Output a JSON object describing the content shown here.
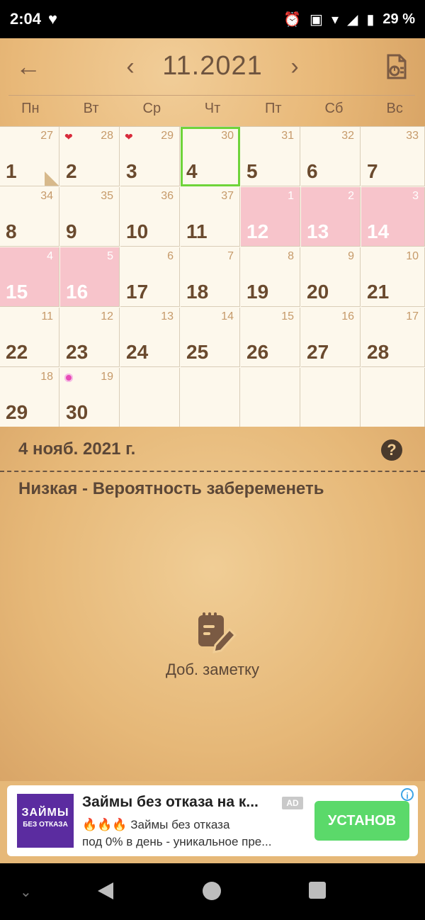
{
  "status": {
    "time": "2:04",
    "heart": "♥",
    "battery": "29 %"
  },
  "header": {
    "month": "11.2021",
    "weekdays": [
      "Пн",
      "Вт",
      "Ср",
      "Чт",
      "Пт",
      "Сб",
      "Вс"
    ]
  },
  "calendar": {
    "cells": [
      {
        "day": "1",
        "wk": "27"
      },
      {
        "day": "2",
        "wk": "28"
      },
      {
        "day": "3",
        "wk": "29"
      },
      {
        "day": "4",
        "wk": "30"
      },
      {
        "day": "5",
        "wk": "31"
      },
      {
        "day": "6",
        "wk": "32"
      },
      {
        "day": "7",
        "wk": "33"
      },
      {
        "day": "8",
        "wk": "34"
      },
      {
        "day": "9",
        "wk": "35"
      },
      {
        "day": "10",
        "wk": "36"
      },
      {
        "day": "11",
        "wk": "37"
      },
      {
        "day": "12",
        "wk": "1"
      },
      {
        "day": "13",
        "wk": "2"
      },
      {
        "day": "14",
        "wk": "3"
      },
      {
        "day": "15",
        "wk": "4"
      },
      {
        "day": "16",
        "wk": "5"
      },
      {
        "day": "17",
        "wk": "6"
      },
      {
        "day": "18",
        "wk": "7"
      },
      {
        "day": "19",
        "wk": "8"
      },
      {
        "day": "20",
        "wk": "9"
      },
      {
        "day": "21",
        "wk": "10"
      },
      {
        "day": "22",
        "wk": "11"
      },
      {
        "day": "23",
        "wk": "12"
      },
      {
        "day": "24",
        "wk": "13"
      },
      {
        "day": "25",
        "wk": "14"
      },
      {
        "day": "26",
        "wk": "15"
      },
      {
        "day": "27",
        "wk": "16"
      },
      {
        "day": "28",
        "wk": "17"
      },
      {
        "day": "29",
        "wk": "18"
      },
      {
        "day": "30",
        "wk": "19"
      }
    ]
  },
  "info": {
    "date": "4 нояб. 2021 г.",
    "probability": "Низкая - Вероятность забеременеть",
    "add_note": "Доб. заметку",
    "help": "?"
  },
  "ad": {
    "logo_l1": "ЗАЙМЫ",
    "logo_l2": "БЕЗ ОТКАЗА",
    "title": "Займы без отказа на к...",
    "badge": "AD",
    "desc1": "🔥🔥🔥 Займы без отказа",
    "desc2": "под 0% в день - уникальное пре...",
    "install": "УСТАНОВ"
  },
  "colors": {
    "leather": "#e6b878",
    "pink_day": "#f7c4cb",
    "selected_outline": "#6fd43a",
    "install_green": "#5bd96a"
  }
}
